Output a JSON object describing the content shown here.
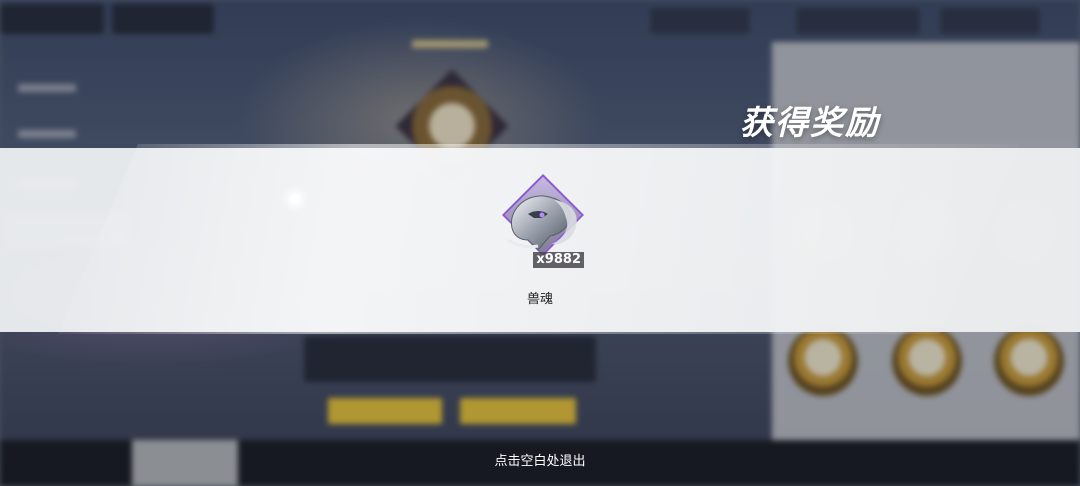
{
  "reward_popup": {
    "title": "获得奖励",
    "item": {
      "name": "兽魂",
      "quantity": "x9882",
      "icon": "beast-soul-icon",
      "frame_color": "#8a5ad6"
    },
    "exit_hint": "点击空白处退出"
  },
  "colors": {
    "banner": "#eceef0",
    "title_text": "#ffffff",
    "background_gold": "#e8c43a"
  }
}
